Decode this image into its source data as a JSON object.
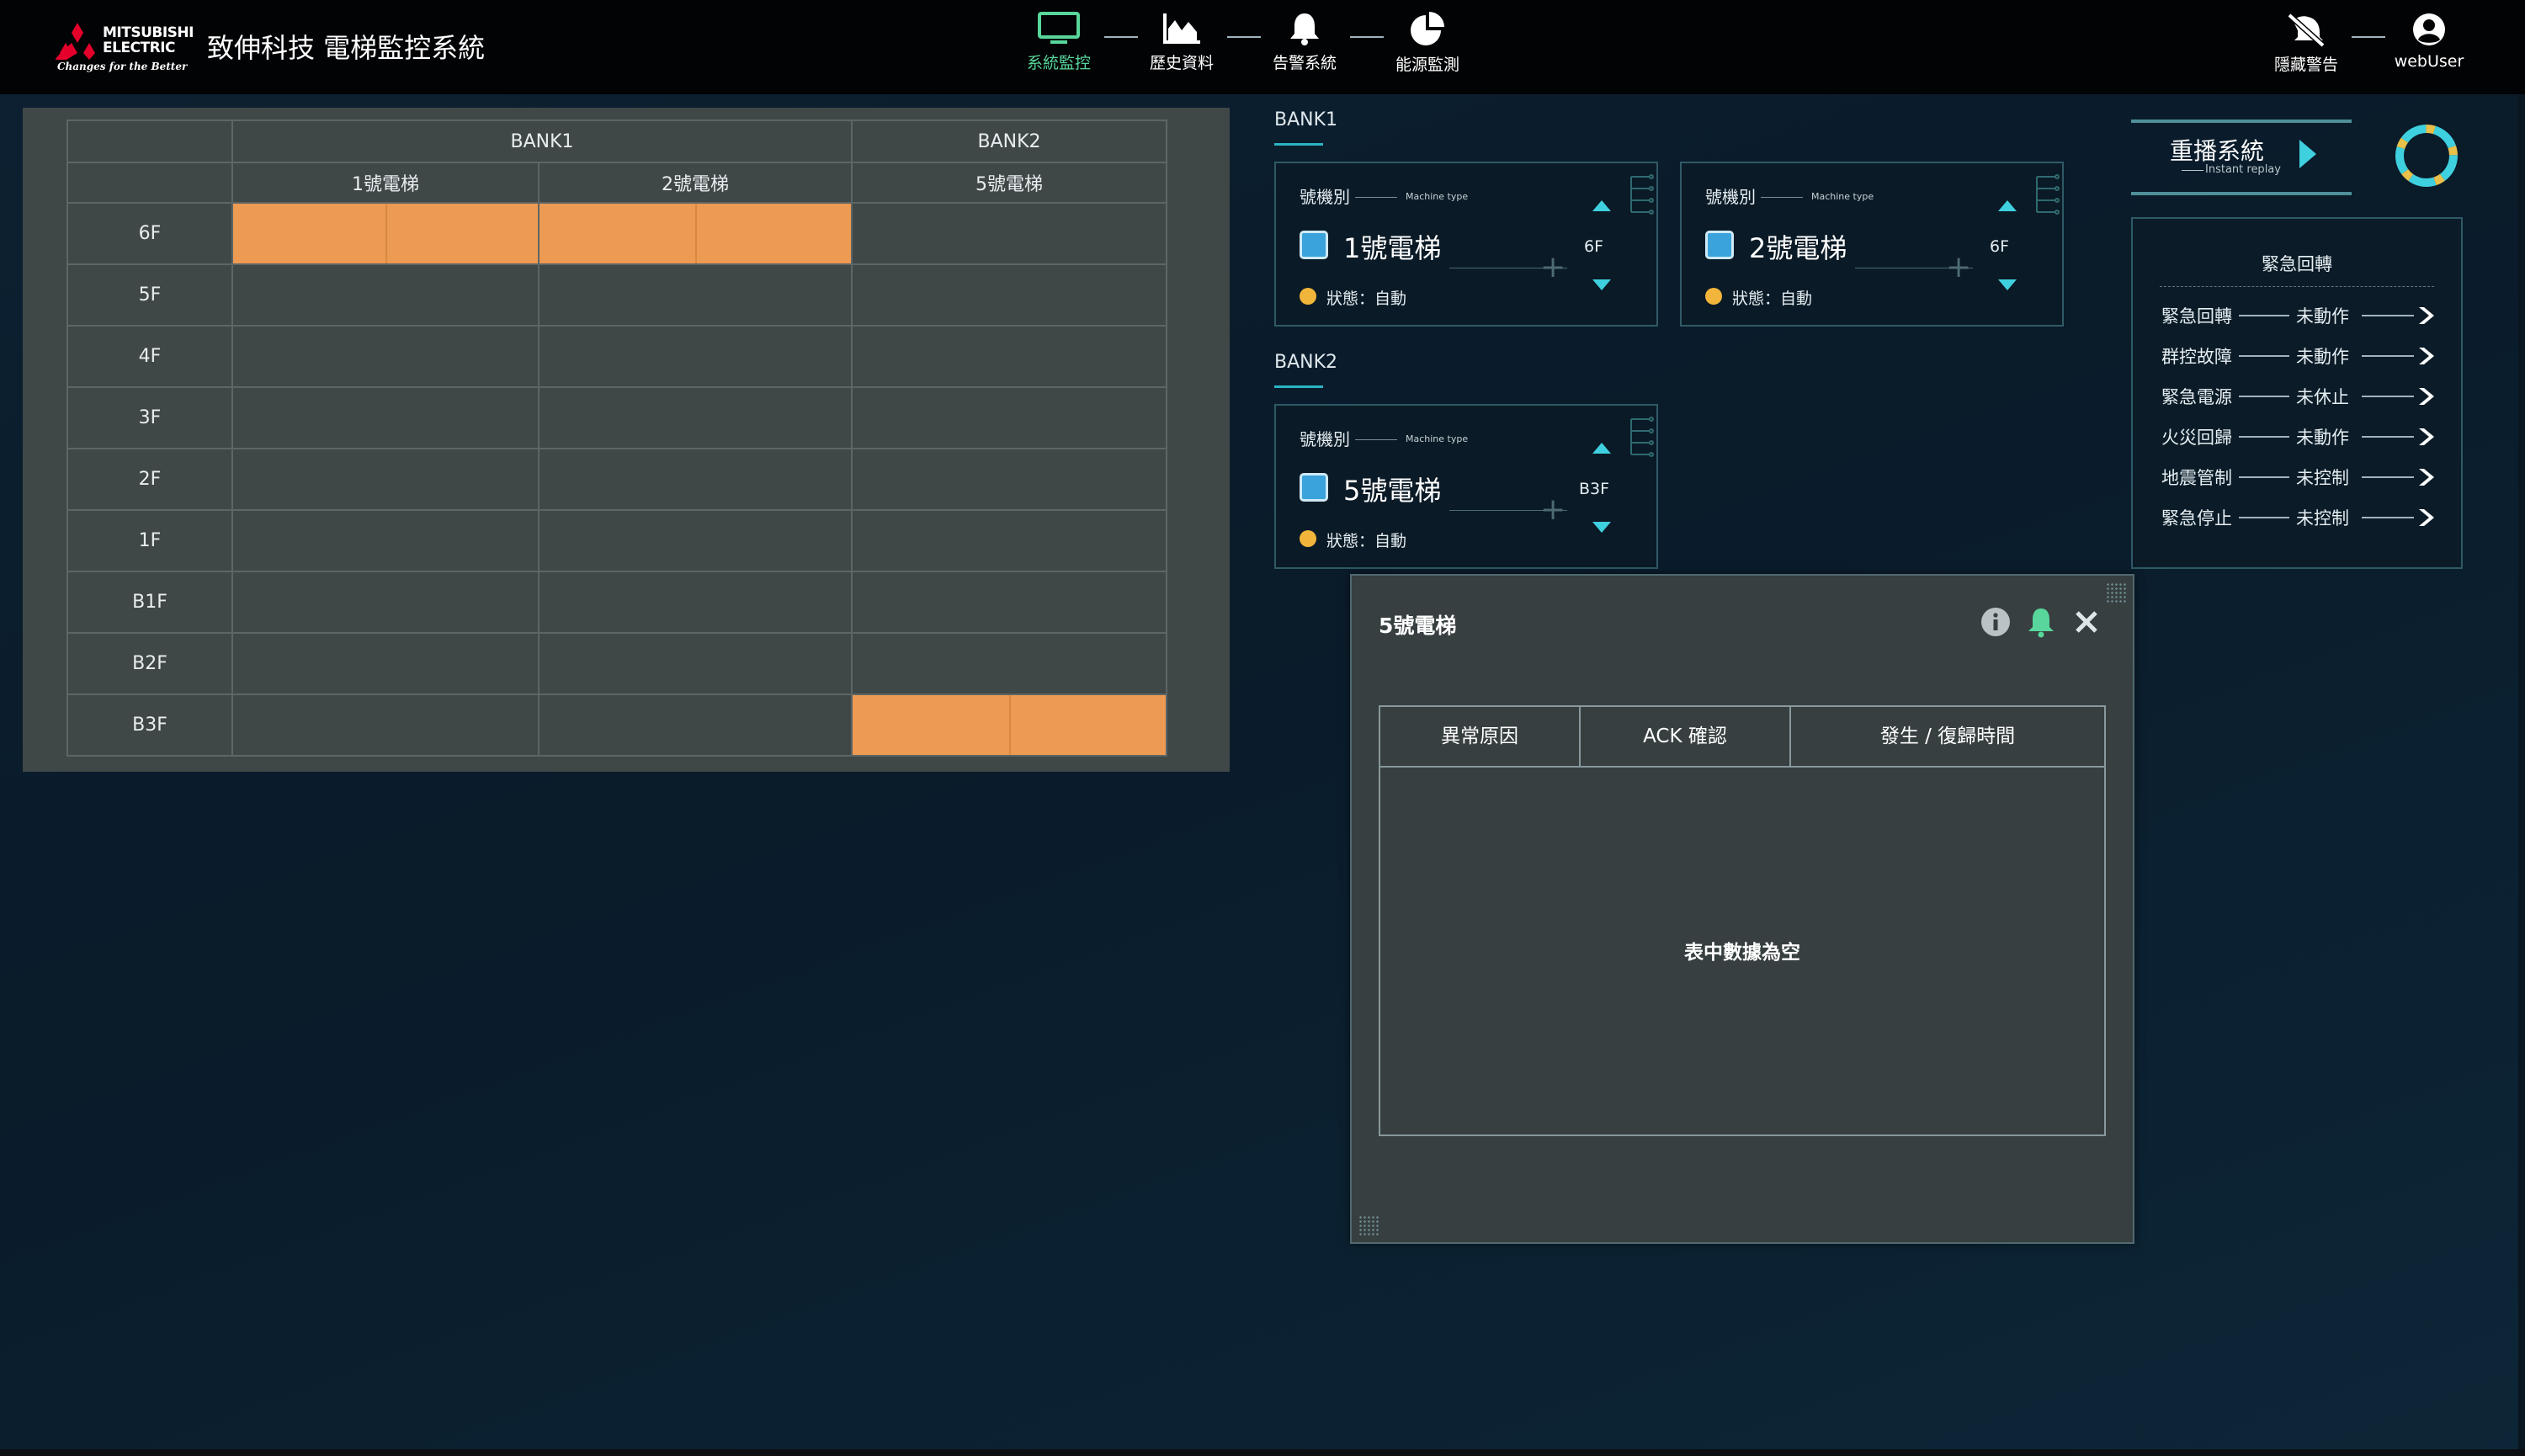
{
  "header": {
    "brand_line1": "MITSUBISHI",
    "brand_line2": "ELECTRIC",
    "brand_tagline": "Changes for the Better",
    "app_title": "致伸科技 電梯監控系統",
    "brand_color": "#e4002b"
  },
  "nav": {
    "items": [
      {
        "label": "系統監控",
        "icon": "monitor-icon",
        "active": true
      },
      {
        "label": "歷史資料",
        "icon": "area-chart-icon",
        "active": false
      },
      {
        "label": "告警系統",
        "icon": "bell-icon",
        "active": false
      },
      {
        "label": "能源監測",
        "icon": "pie-chart-icon",
        "active": false
      }
    ],
    "right": [
      {
        "label": "隱藏警告",
        "icon": "alert-off-icon"
      },
      {
        "label": "webUser",
        "icon": "user-icon"
      }
    ],
    "active_color": "#58d69b"
  },
  "floor_grid": {
    "banks": [
      {
        "name": "BANK1",
        "elevators": [
          "1號電梯",
          "2號電梯"
        ]
      },
      {
        "name": "BANK2",
        "elevators": [
          "5號電梯"
        ]
      }
    ],
    "floors": [
      "6F",
      "5F",
      "4F",
      "3F",
      "2F",
      "1F",
      "B1F",
      "B2F",
      "B3F"
    ],
    "car_positions": {
      "1號電梯": "6F",
      "2號電梯": "6F",
      "5號電梯": "B3F"
    },
    "car_color": "#ed9a52"
  },
  "bank_panels": [
    {
      "title": "BANK1",
      "cards": [
        {
          "machine_label": "號機別",
          "machine_type": "Machine type",
          "name": "1號電梯",
          "floor": "6F",
          "status": "狀態：自動"
        },
        {
          "machine_label": "號機別",
          "machine_type": "Machine type",
          "name": "2號電梯",
          "floor": "6F",
          "status": "狀態：自動"
        }
      ]
    },
    {
      "title": "BANK2",
      "cards": [
        {
          "machine_label": "號機別",
          "machine_type": "Machine type",
          "name": "5號電梯",
          "floor": "B3F",
          "status": "狀態：自動"
        }
      ]
    }
  ],
  "replay": {
    "label": "重播系統",
    "sub": "Instant replay"
  },
  "emergency": {
    "title": "緊急回轉",
    "rows": [
      {
        "name": "緊急回轉",
        "state": "未動作"
      },
      {
        "name": "群控故障",
        "state": "未動作"
      },
      {
        "name": "緊急電源",
        "state": "未休止"
      },
      {
        "name": "火災回歸",
        "state": "未動作"
      },
      {
        "name": "地震管制",
        "state": "未控制"
      },
      {
        "name": "緊急停止",
        "state": "未控制"
      }
    ]
  },
  "popup": {
    "title": "5號電梯",
    "columns": [
      "異常原因",
      "ACK 確認",
      "發生 / 復歸時間"
    ],
    "empty_text": "表中數據為空"
  }
}
